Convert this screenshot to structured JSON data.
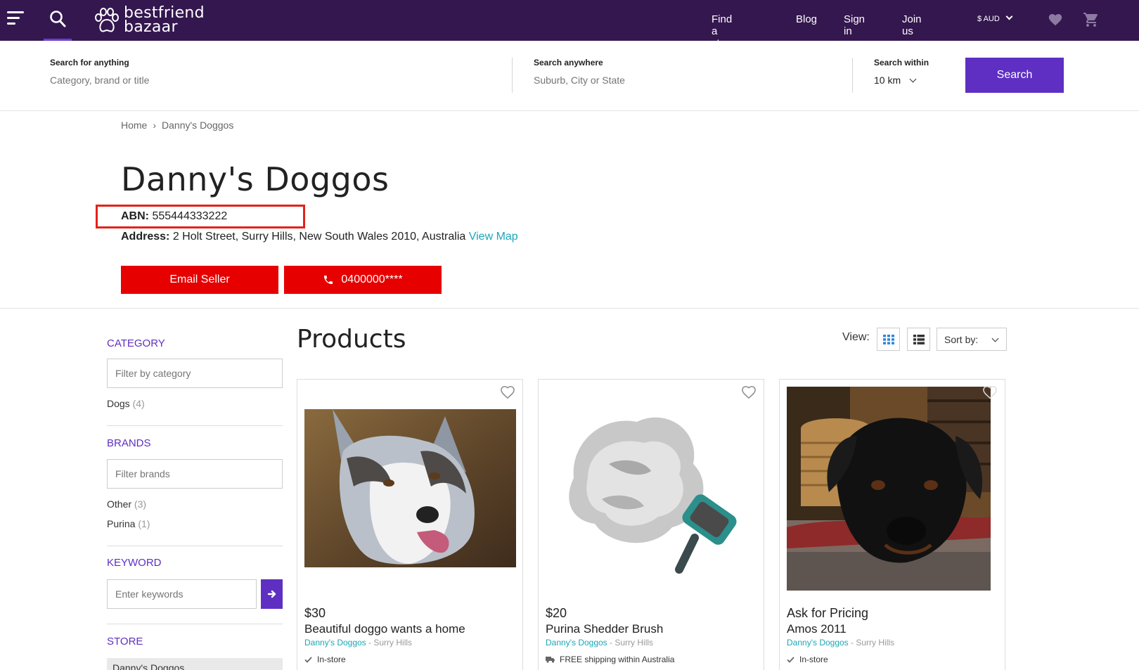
{
  "nav": {
    "logo_line1": "bestfriend",
    "logo_line2": "bazaar",
    "links": [
      "Find a store",
      "Blog",
      "Sign in",
      "Join us"
    ],
    "currency": "$ AUD"
  },
  "search": {
    "anything_label": "Search for anything",
    "anything_placeholder": "Category, brand or title",
    "anywhere_label": "Search anywhere",
    "anywhere_placeholder": "Suburb, City or State",
    "within_label": "Search within",
    "within_value": "10 km",
    "button": "Search"
  },
  "breadcrumb": {
    "home": "Home",
    "sep": "›",
    "current": "Danny's Doggos"
  },
  "store": {
    "title": "Danny's Doggos",
    "abn_label": "ABN:",
    "abn": "555444333222",
    "address_label": "Address:",
    "address": "2 Holt Street, Surry Hills, New South Wales 2010, Australia",
    "view_map": "View Map",
    "email_button": "Email Seller",
    "phone_button": "0400000****"
  },
  "sidebar": {
    "category_heading": "CATEGORY",
    "category_placeholder": "Filter by category",
    "categories": [
      {
        "name": "Dogs",
        "count": "(4)"
      }
    ],
    "brands_heading": "BRANDS",
    "brands_placeholder": "Filter brands",
    "brands": [
      {
        "name": "Other",
        "count": "(3)"
      },
      {
        "name": "Purina",
        "count": "(1)"
      }
    ],
    "keyword_heading": "KEYWORD",
    "keyword_placeholder": "Enter keywords",
    "store_heading": "STORE",
    "store_value": "Danny's Doggos"
  },
  "products": {
    "heading": "Products",
    "view_label": "View:",
    "sort_label": "Sort by:",
    "items": [
      {
        "price": "$30",
        "title": "Beautiful doggo wants a home",
        "store": "Danny's Doggos",
        "location": " - Surry Hills",
        "delivery": "In-store"
      },
      {
        "price": "$20",
        "title": "Purina Shedder Brush",
        "store": "Danny's Doggos",
        "location": " - Surry Hills",
        "delivery": "FREE shipping within Australia"
      },
      {
        "price": "Ask for Pricing",
        "title": "Amos 2011",
        "store": "Danny's Doggos",
        "location": " - Surry Hills",
        "delivery": "In-store"
      }
    ]
  },
  "colors": {
    "nav_bg": "#34174f",
    "accent": "#5e2fc2",
    "cta_red": "#e60000",
    "link_teal": "#1aa7b7",
    "highlight_box": "#e2231a"
  }
}
